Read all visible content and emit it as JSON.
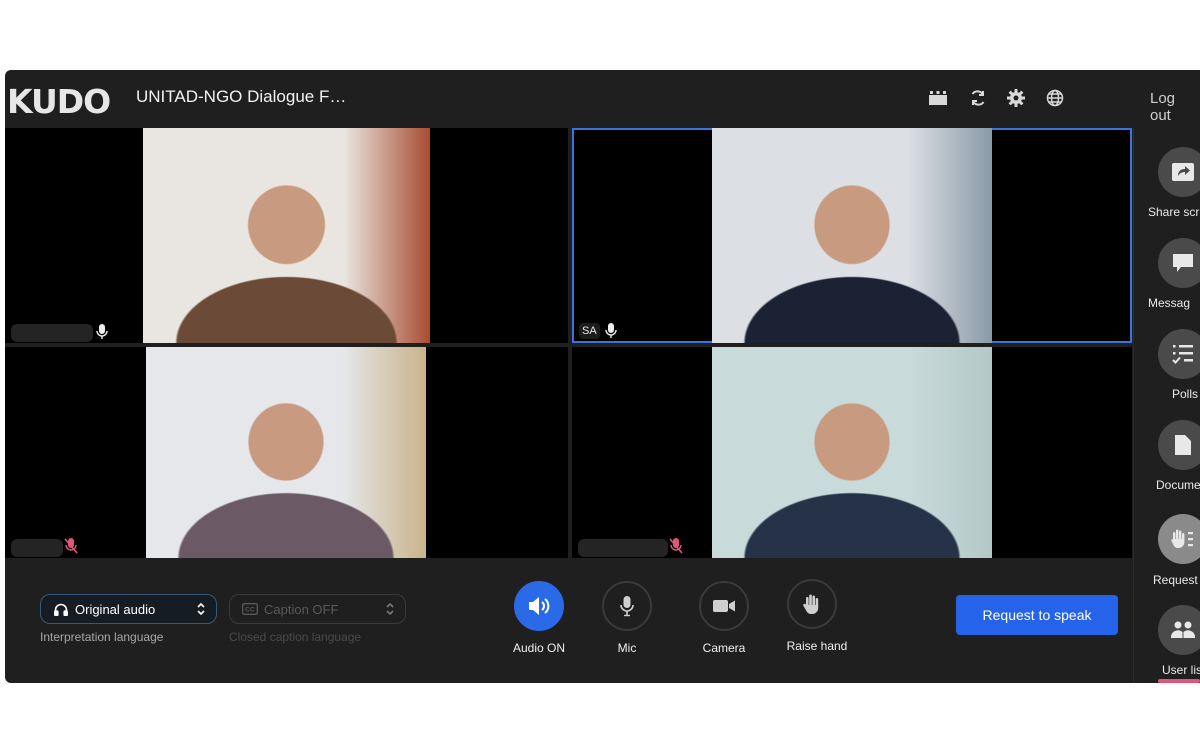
{
  "header": {
    "logo": "KUDO",
    "title": "UNITAD-NGO Dialogue F…",
    "icons": [
      "layout-icon",
      "refresh-icon",
      "gear-icon",
      "globe-icon"
    ],
    "logout": "Log out"
  },
  "participants": [
    {
      "initials": "",
      "mic": "on",
      "active": false,
      "feed_colors": [
        "#e9e5e0",
        "#6b4a38",
        "#a84d32"
      ]
    },
    {
      "initials": "SA",
      "mic": "on",
      "active": true,
      "feed_colors": [
        "#dcdfe3",
        "#1b2233",
        "#8a9aa8"
      ]
    },
    {
      "initials": "",
      "mic": "muted",
      "active": false,
      "feed_colors": [
        "#e5e7ea",
        "#6b5a66",
        "#c9b38a"
      ]
    },
    {
      "initials": "",
      "mic": "muted",
      "active": false,
      "feed_colors": [
        "#c9dada",
        "#253248",
        "#b4c8c8"
      ]
    }
  ],
  "controls": {
    "interpretation": {
      "value": "Original audio",
      "label": "Interpretation language"
    },
    "caption": {
      "value": "Caption OFF",
      "label": "Closed caption language"
    },
    "buttons": [
      {
        "label": "Audio ON",
        "icon": "speaker-icon",
        "active": true
      },
      {
        "label": "Mic",
        "icon": "mic-icon",
        "active": false
      },
      {
        "label": "Camera",
        "icon": "camera-icon",
        "active": false
      },
      {
        "label": "Raise hand",
        "icon": "hand-icon",
        "active": false
      }
    ],
    "request_to_speak": "Request to speak"
  },
  "rail": [
    {
      "label": "Share scr",
      "icon": "share-screen-icon"
    },
    {
      "label": "Messag",
      "icon": "message-icon"
    },
    {
      "label": "Polls",
      "icon": "polls-icon"
    },
    {
      "label": "Docume",
      "icon": "document-icon"
    },
    {
      "label": "Request",
      "icon": "request-hand-icon"
    },
    {
      "label": "User lis",
      "icon": "users-icon"
    }
  ],
  "colors": {
    "accent": "#2563eb",
    "active_border": "#3b72e0",
    "muted": "#e0567a"
  }
}
